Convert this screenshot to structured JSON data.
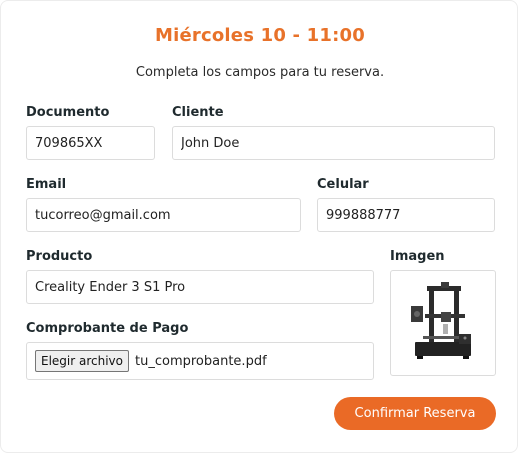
{
  "form": {
    "title": "Miércoles 10 - 11:00",
    "subtitle": "Completa los campos para tu reserva.",
    "documento": {
      "label": "Documento",
      "value": "709865XX"
    },
    "cliente": {
      "label": "Cliente",
      "value": "John Doe"
    },
    "email": {
      "label": "Email",
      "value": "tucorreo@gmail.com"
    },
    "celular": {
      "label": "Celular",
      "value": "999888777"
    },
    "producto": {
      "label": "Producto",
      "value": "Creality Ender 3 S1 Pro"
    },
    "imagen": {
      "label": "Imagen",
      "icon": "3d-printer-image"
    },
    "comprobante": {
      "label": "Comprobante de Pago",
      "button_label": "Elegir archivo",
      "file_name": "tu_comprobante.pdf"
    },
    "submit_label": "Confirmar Reserva"
  },
  "colors": {
    "accent": "#e8722a",
    "button": "#ea6a26",
    "border": "#dcdcdc"
  }
}
